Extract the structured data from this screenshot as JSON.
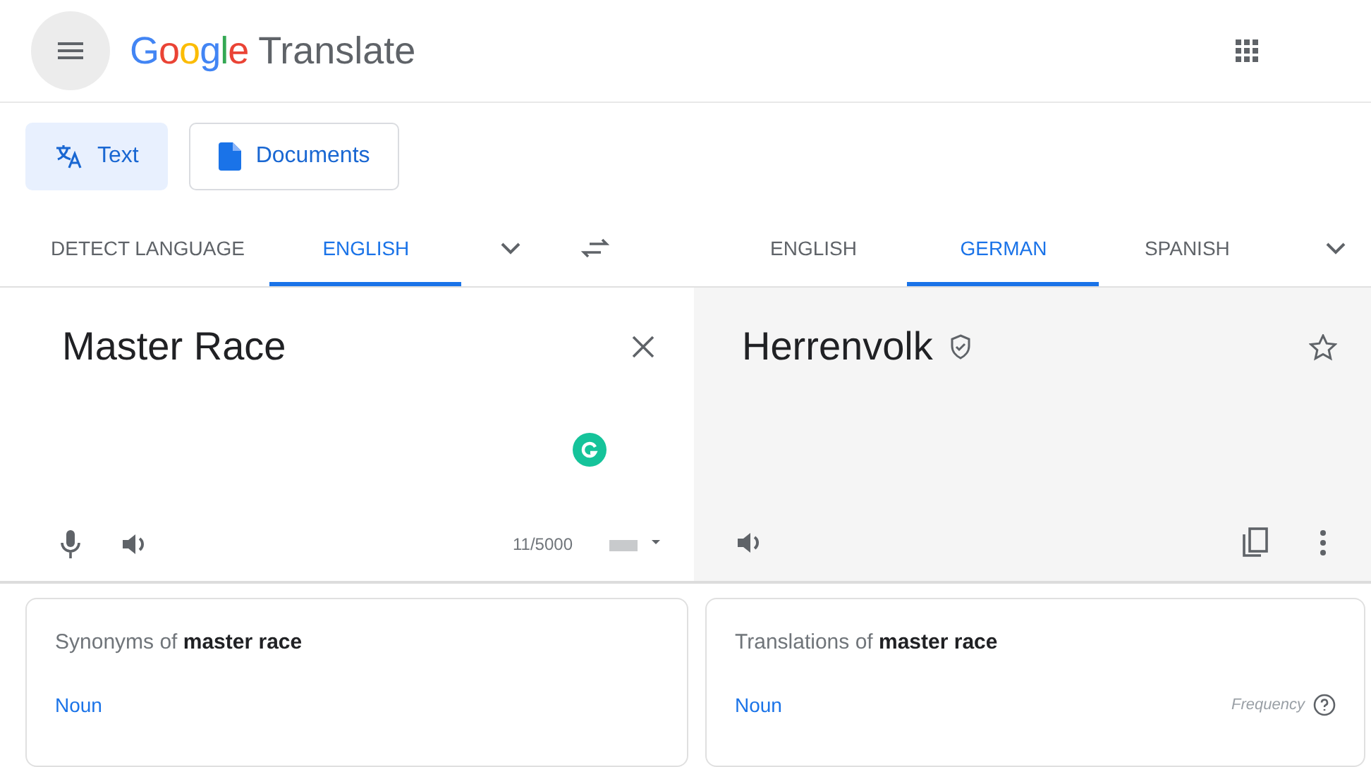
{
  "header": {
    "brand": "Google",
    "product": "Translate"
  },
  "modes": [
    {
      "label": "Text",
      "kind": "text",
      "selected": true
    },
    {
      "label": "Documents",
      "kind": "documents",
      "selected": false
    }
  ],
  "source_languages": [
    {
      "label": "DETECT LANGUAGE",
      "selected": false
    },
    {
      "label": "ENGLISH",
      "selected": true
    }
  ],
  "target_languages": [
    {
      "label": "ENGLISH",
      "selected": false
    },
    {
      "label": "GERMAN",
      "selected": true
    },
    {
      "label": "SPANISH",
      "selected": false
    }
  ],
  "source": {
    "text": "Master Race",
    "counter": "11/5000"
  },
  "target": {
    "text": "Herrenvolk",
    "verified": true,
    "starred": false
  },
  "cards": [
    {
      "title": "Synonyms of **master race**",
      "part_of_speech": "Noun"
    },
    {
      "title": "Translations of **master race**",
      "part_of_speech": "Noun",
      "note": "Frequency"
    }
  ]
}
